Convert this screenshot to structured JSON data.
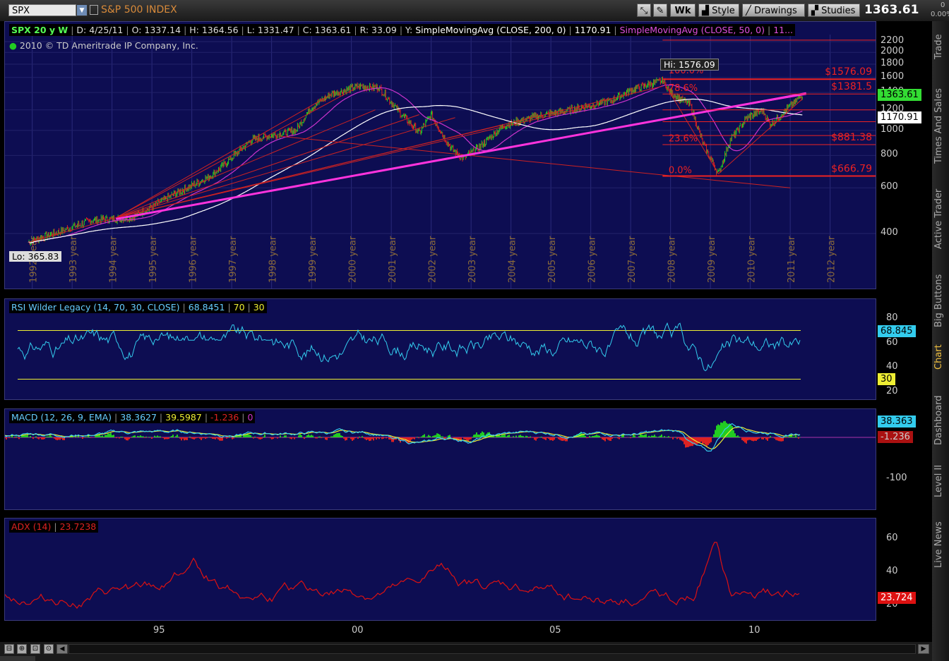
{
  "toolbar": {
    "symbol": "SPX",
    "description": "S&P 500 INDEX",
    "buttons": {
      "wk": "Wk",
      "style": "Style",
      "drawings": "Drawings",
      "studies": "Studies"
    },
    "last_price": "1363.61",
    "change_top": "0",
    "change_pct": "0.00%"
  },
  "price_panel": {
    "header": {
      "symbol_period": "SPX 20 y W",
      "date": "D: 4/25/11",
      "open": "O: 1337.14",
      "high": "H: 1364.56",
      "low": "L: 1331.47",
      "close": "C: 1363.61",
      "range": "R: 33.09",
      "y": "Y:",
      "sma200_label": "SimpleMovingAvg (CLOSE, 200, 0)",
      "sma200_value": "1170.91",
      "sma50_label": "SimpleMovingAvg (CLOSE, 50, 0)",
      "sma50_value": "11..."
    },
    "copyright": "2010 © TD Ameritrade IP Company, Inc.",
    "hi_label": "Hi: 1576.09",
    "lo_label": "Lo: 365.83",
    "fib_labels": [
      "100.0%",
      "78.6%",
      "23.6%",
      "0.0%"
    ],
    "price_labels": [
      "$1576.09",
      "$1381.5",
      "$881.38",
      "$666.79"
    ],
    "y_ticks": [
      "2200",
      "2000",
      "1800",
      "1600",
      "1400",
      "1200",
      "1000",
      "800",
      "600",
      "400"
    ],
    "last_price_tag": "1363.61",
    "sma_tag": "1170.91",
    "year_labels": [
      "1992 year",
      "1993 year",
      "1994 year",
      "1995 year",
      "1996 year",
      "1997 year",
      "1998 year",
      "1999 year",
      "2000 year",
      "2001 year",
      "2002 year",
      "2003 year",
      "2004 year",
      "2005 year",
      "2006 year",
      "2007 year",
      "2008 year",
      "2009 year",
      "2010 year",
      "2011 year",
      "2012 year"
    ]
  },
  "rsi_panel": {
    "label": "RSI Wilder Legacy (14, 70, 30, CLOSE)",
    "value": "68.8451",
    "ob": "70",
    "os": "30",
    "ticks": [
      "80",
      "60",
      "40",
      "20"
    ],
    "value_tag": "68.845",
    "os_tag": "30"
  },
  "macd_panel": {
    "label": "MACD (12, 26, 9, EMA)",
    "value": "38.3627",
    "avg": "39.5987",
    "diff": "-1.236",
    "zero": "0",
    "ticks": [
      "-100"
    ],
    "value_tag": "38.363",
    "diff_tag": "-1.236"
  },
  "adx_panel": {
    "label": "ADX (14)",
    "value": "23.7238",
    "ticks": [
      "60",
      "40",
      "20"
    ],
    "value_tag": "23.724"
  },
  "x_axis": [
    "95",
    "00",
    "05",
    "10"
  ],
  "sidebar_tabs": [
    "Trade",
    "Times And Sales",
    "Active Trader",
    "Big Buttons",
    "Chart",
    "Dashboard",
    "Level II",
    "Live News"
  ],
  "colors": {
    "panel_bg": "#0d0d52",
    "candle_up": "#22cc22",
    "candle_down": "#dd2222",
    "sma50": "#cc33cc",
    "sma200": "#ffffff",
    "trend": "#ff33dd",
    "fib": "#ee2222",
    "rsi": "#33ccee",
    "macd_signal": "#eeee33",
    "adx": "#dd1111"
  }
}
